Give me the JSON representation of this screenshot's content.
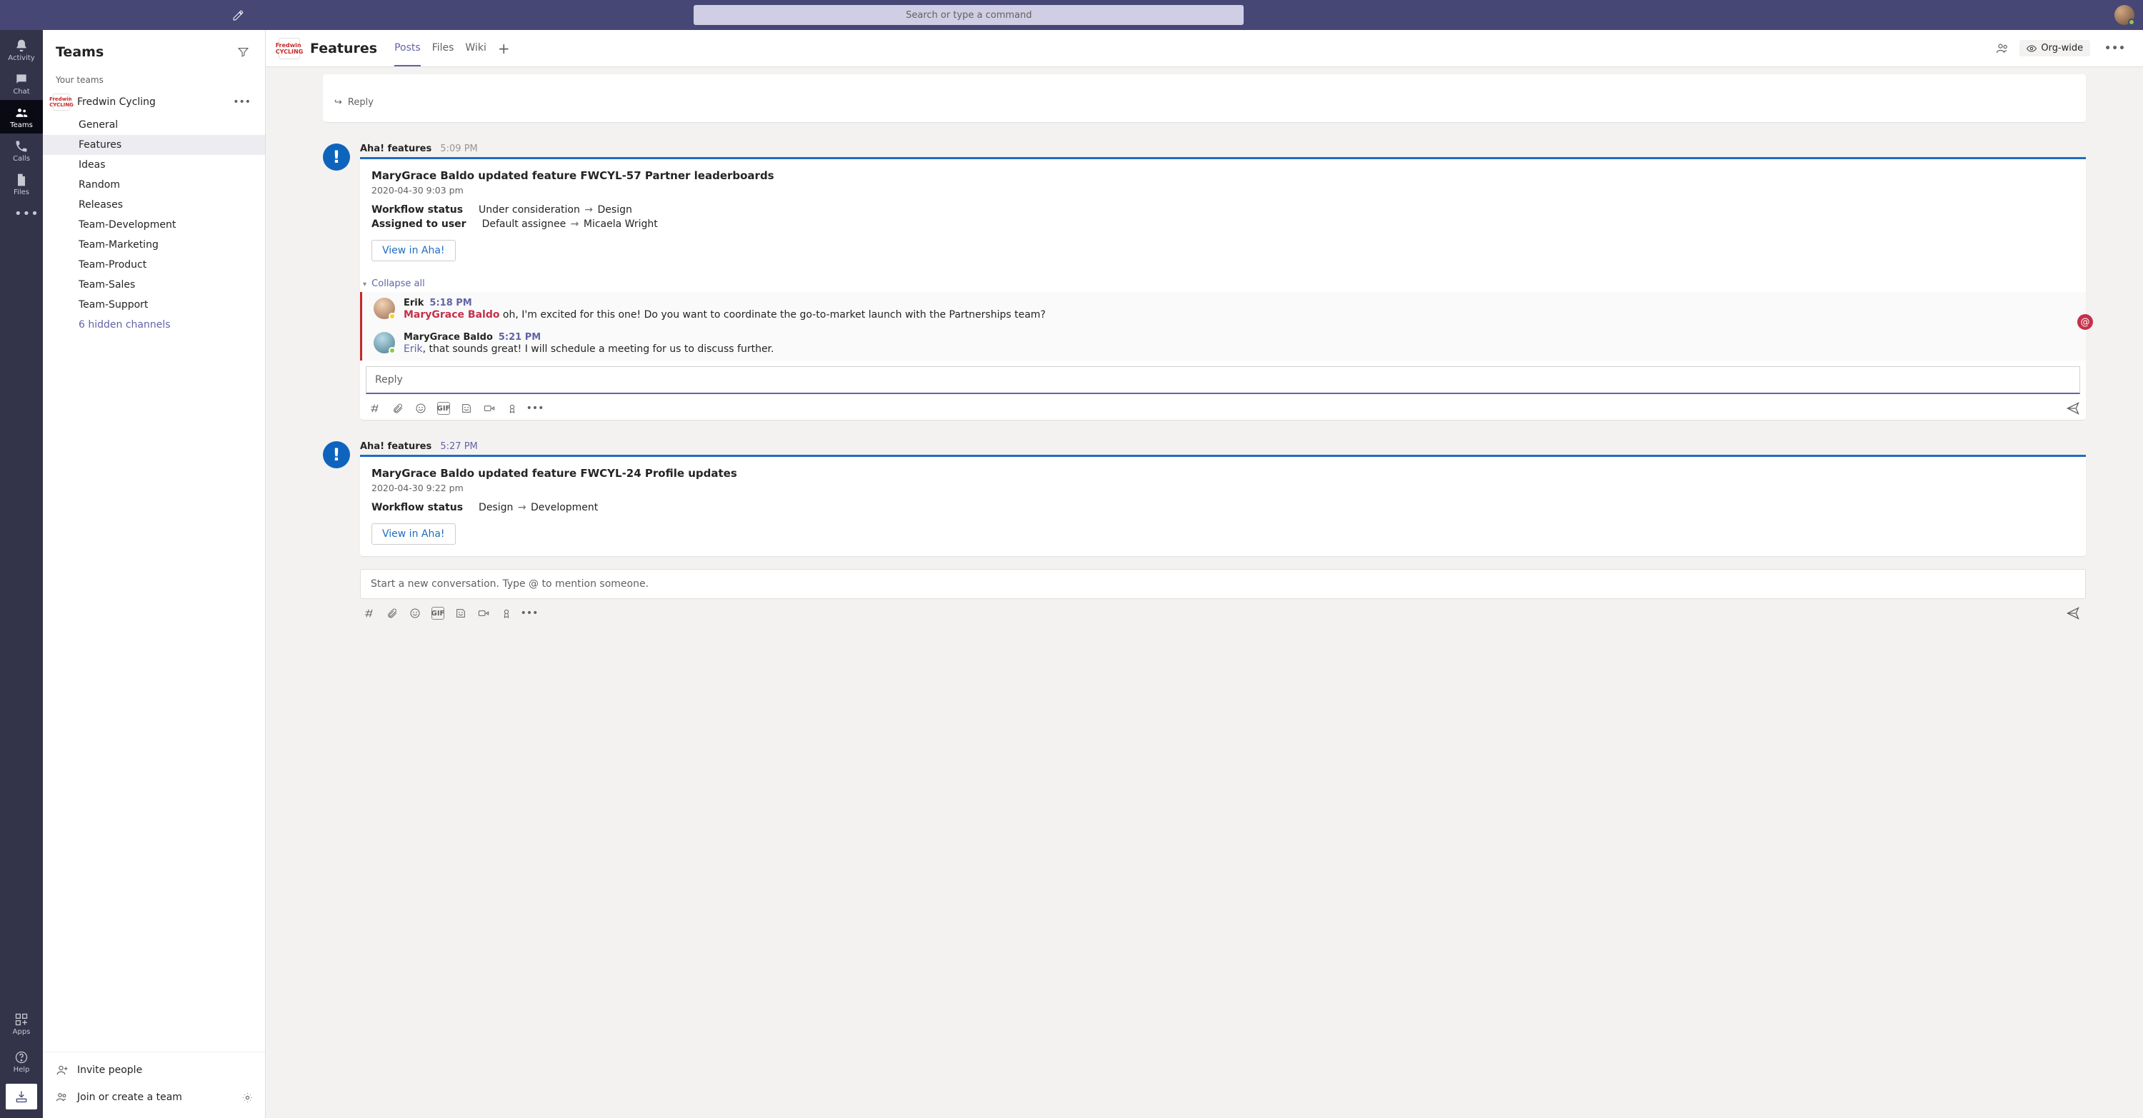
{
  "search": {
    "placeholder": "Search or type a command"
  },
  "apprail": {
    "activity": "Activity",
    "chat": "Chat",
    "teams": "Teams",
    "calls": "Calls",
    "files": "Files",
    "apps": "Apps",
    "help": "Help"
  },
  "sidebar": {
    "title": "Teams",
    "section_label": "Your teams",
    "team_name": "Fredwin Cycling",
    "hidden_channels": "6 hidden channels",
    "invite": "Invite people",
    "join_create": "Join or create a team",
    "channels": [
      {
        "label": "General"
      },
      {
        "label": "Features"
      },
      {
        "label": "Ideas"
      },
      {
        "label": "Random"
      },
      {
        "label": "Releases"
      },
      {
        "label": "Team-Development"
      },
      {
        "label": "Team-Marketing"
      },
      {
        "label": "Team-Product"
      },
      {
        "label": "Team-Sales"
      },
      {
        "label": "Team-Support"
      }
    ]
  },
  "channel_header": {
    "title": "Features",
    "tabs": {
      "posts": "Posts",
      "files": "Files",
      "wiki": "Wiki"
    },
    "scope": "Org-wide"
  },
  "posts": {
    "prev_reply": "Reply",
    "post1": {
      "author": "Aha! features",
      "time": "5:09 PM",
      "title": "MaryGrace Baldo updated feature FWCYL-57 Partner leaderboards",
      "dt": "2020-04-30 9:03 pm",
      "k1": "Workflow status",
      "v1a": "Under consideration",
      "v1b": "Design",
      "k2": "Assigned to user",
      "v2a": "Default assignee",
      "v2b": "Micaela Wright",
      "button": "View in Aha!",
      "collapse": "Collapse all",
      "reply1": {
        "name": "Erik",
        "time": "5:18 PM",
        "mention": "MaryGrace Baldo",
        "text": " oh, I'm excited for this one! Do you want to coordinate the go-to-market launch with the Partnerships team?"
      },
      "reply2": {
        "name": "MaryGrace Baldo",
        "time": "5:21 PM",
        "mention": "Erik",
        "text": ", that sounds great! I will schedule a meeting for us to discuss further."
      },
      "reply_placeholder": "Reply"
    },
    "post2": {
      "author": "Aha! features",
      "time": "5:27 PM",
      "title": "MaryGrace Baldo updated feature FWCYL-24 Profile updates",
      "dt": "2020-04-30 9:22 pm",
      "k1": "Workflow status",
      "v1a": "Design",
      "v1b": "Development",
      "button": "View in Aha!"
    },
    "new_conv": "Start a new conversation. Type @ to mention someone."
  }
}
